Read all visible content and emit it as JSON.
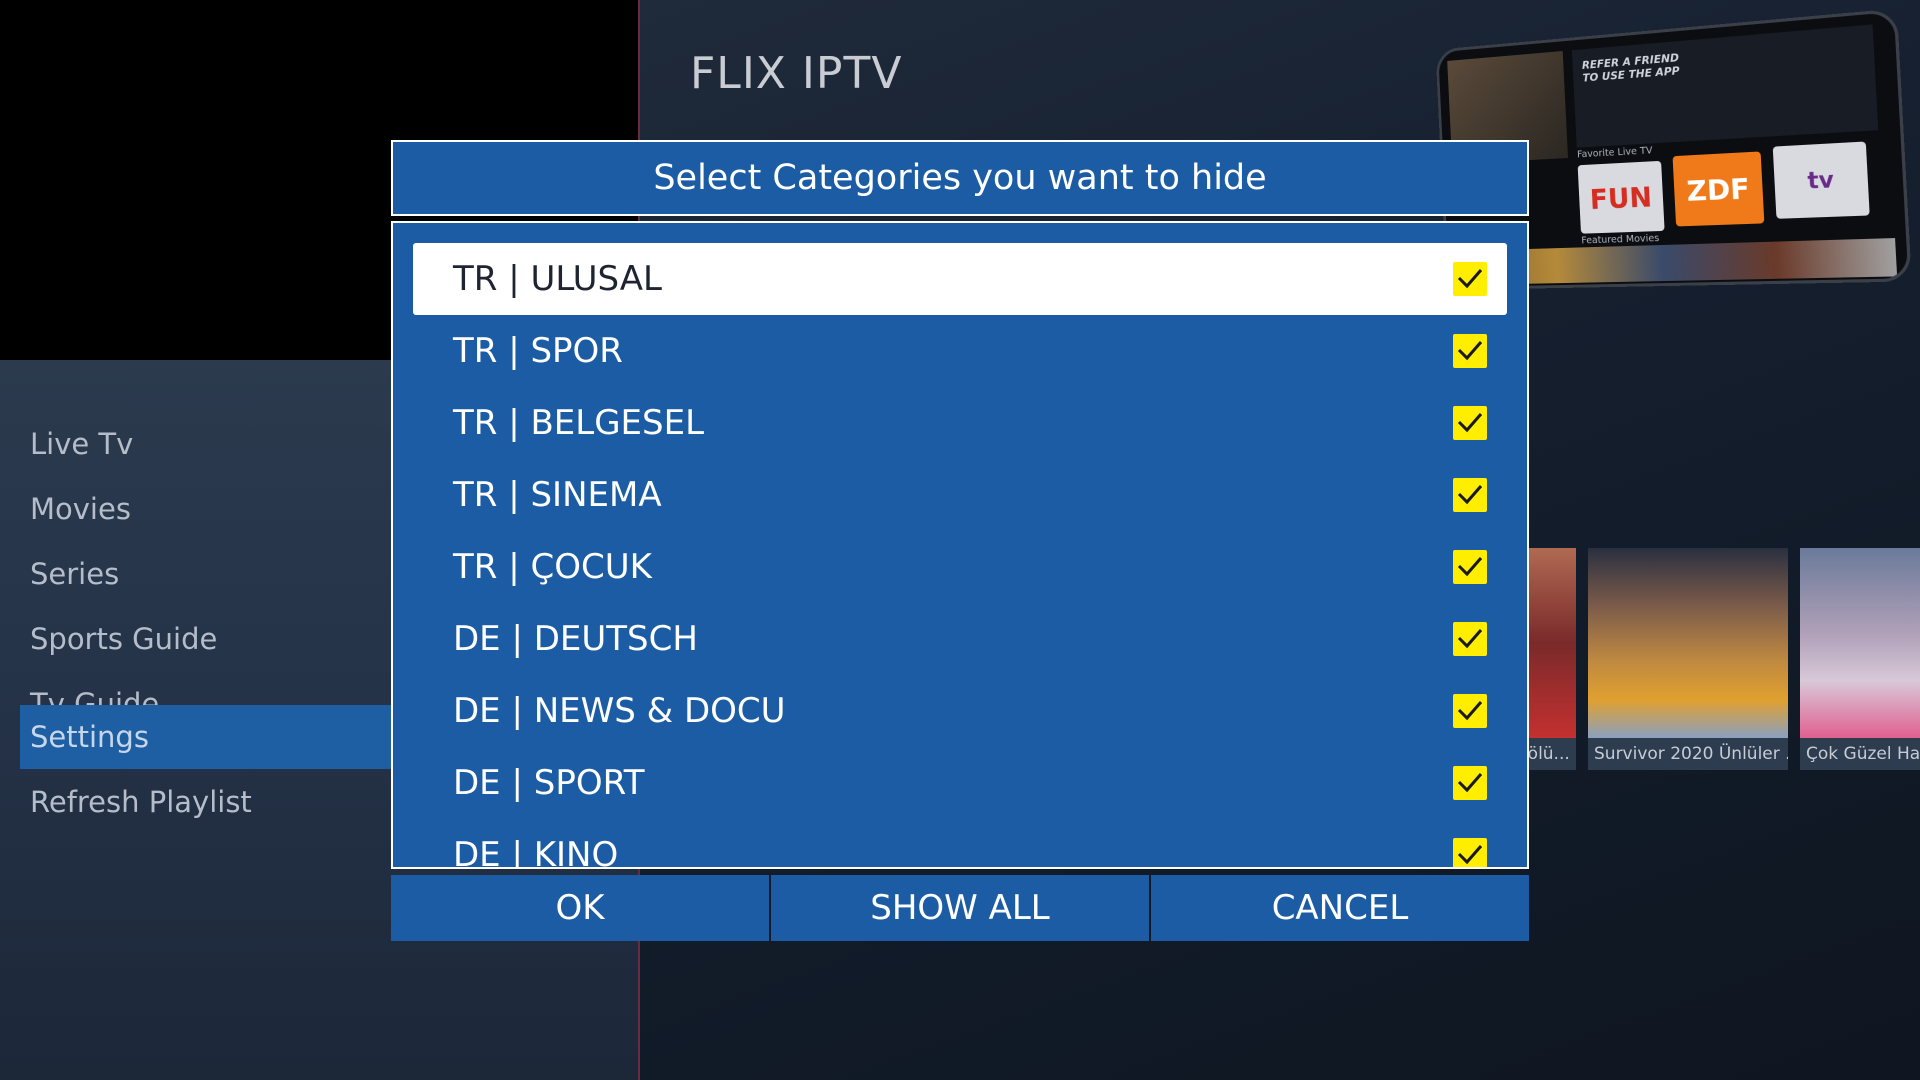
{
  "app": {
    "brand": "FLIX IPTV"
  },
  "sidebar": {
    "items": [
      {
        "label": "Live Tv",
        "active": false
      },
      {
        "label": "Movies",
        "active": false
      },
      {
        "label": "Series",
        "active": false
      },
      {
        "label": "Sports Guide",
        "active": false
      },
      {
        "label": "Tv Guide",
        "active": false
      },
      {
        "label": "Settings",
        "active": true
      },
      {
        "label": "Refresh Playlist",
        "active": false
      }
    ]
  },
  "promo": {
    "refer_text": "REFER A FRIEND TO USE THE APP",
    "favorite_label": "Favorite Live TV",
    "featured_label": "Featured Movies",
    "channels": [
      "FUN",
      "ZDF",
      "tv"
    ]
  },
  "posters": [
    {
      "caption": "Bölü..."
    },
    {
      "caption": "Survivor 2020 Ünlüler ..."
    },
    {
      "caption": "Çok Güzel Har"
    }
  ],
  "dialog": {
    "title": "Select Categories you want to hide",
    "categories": [
      {
        "label": "TR | ULUSAL",
        "checked": true,
        "focused": true
      },
      {
        "label": "TR | SPOR",
        "checked": true,
        "focused": false
      },
      {
        "label": "TR | BELGESEL",
        "checked": true,
        "focused": false
      },
      {
        "label": "TR | SINEMA",
        "checked": true,
        "focused": false
      },
      {
        "label": "TR | ÇOCUK",
        "checked": true,
        "focused": false
      },
      {
        "label": "DE | DEUTSCH",
        "checked": true,
        "focused": false
      },
      {
        "label": "DE | NEWS & DOCU",
        "checked": true,
        "focused": false
      },
      {
        "label": "DE | SPORT",
        "checked": true,
        "focused": false
      },
      {
        "label": "DE | KINO",
        "checked": true,
        "focused": false
      }
    ],
    "buttons": {
      "ok": "OK",
      "show_all": "SHOW ALL",
      "cancel": "CANCEL"
    }
  },
  "colors": {
    "dialog_blue": "#1b5ca4",
    "checkbox_yellow": "#ffee00",
    "active_menu": "#1e5ea3"
  }
}
